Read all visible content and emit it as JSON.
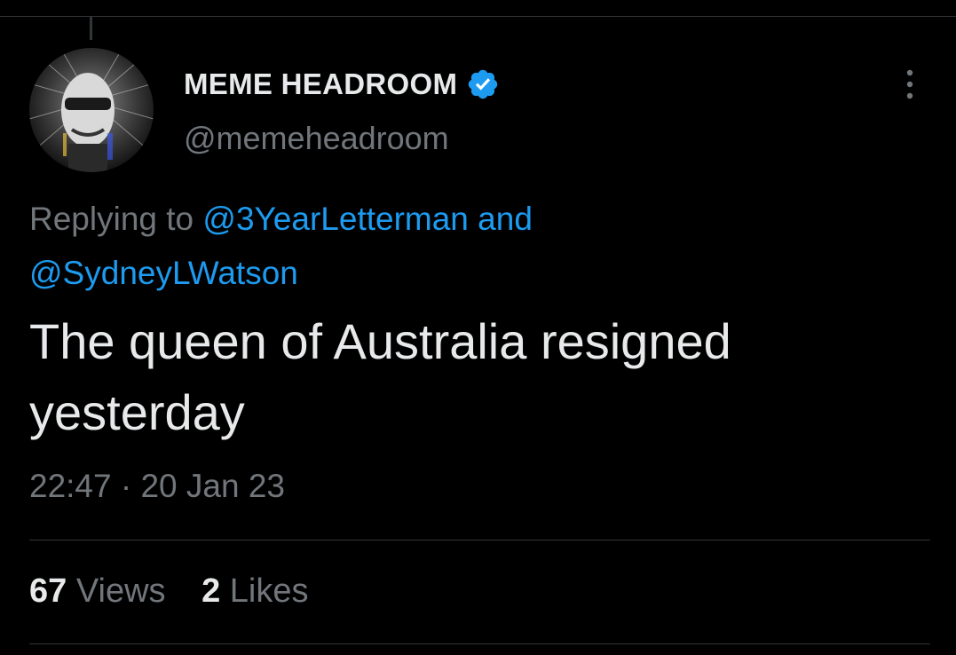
{
  "author": {
    "display_name": "MEME HEADROOM",
    "handle": "@memeheadroom",
    "verified_color": "#1d9bf0"
  },
  "reply_context": {
    "prefix": "Replying to",
    "mention_1": "@3YearLetterman",
    "conjunction": "and",
    "mention_2": "@SydneyLWatson"
  },
  "tweet": {
    "text": "The queen of Australia resigned yesterday",
    "time": "22:47",
    "separator": "·",
    "date": "20 Jan 23"
  },
  "stats": {
    "views_count": "67",
    "views_label": "Views",
    "likes_count": "2",
    "likes_label": "Likes"
  },
  "colors": {
    "background": "#000000",
    "text_primary": "#e7e9ea",
    "text_secondary": "#71767b",
    "link": "#1d9bf0",
    "divider": "#2f3336"
  },
  "icons": {
    "verified": "verified-badge-icon",
    "more": "more-options-icon"
  }
}
